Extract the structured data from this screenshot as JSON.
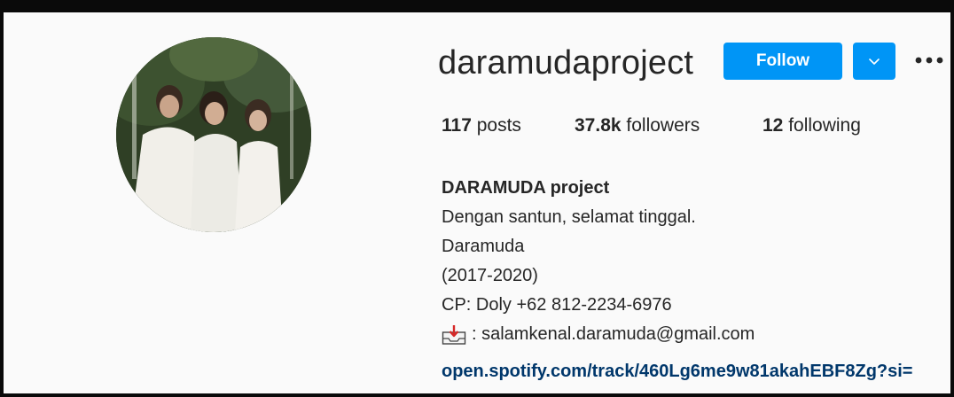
{
  "profile": {
    "username": "daramudaproject",
    "follow_label": "Follow",
    "more_label": "•••",
    "avatar_alt": "profile-photo"
  },
  "stats": {
    "posts_count": "117",
    "posts_label": " posts",
    "followers_count": "37.8k",
    "followers_label": " followers",
    "following_count": "12",
    "following_label": " following"
  },
  "bio": {
    "full_name": "DARAMUDA project",
    "lines": [
      "Dengan santun, selamat tinggal.",
      "Daramuda",
      "(2017-2020)",
      "CP: Doly +62 812-2234-6976"
    ],
    "email_text": ": salamkenal.daramuda@gmail.com",
    "link": "open.spotify.com/track/460Lg6me9w81akahEBF8Zg?si="
  },
  "colors": {
    "accent": "#0095f6",
    "link": "#00376b",
    "background": "#fafafa"
  }
}
